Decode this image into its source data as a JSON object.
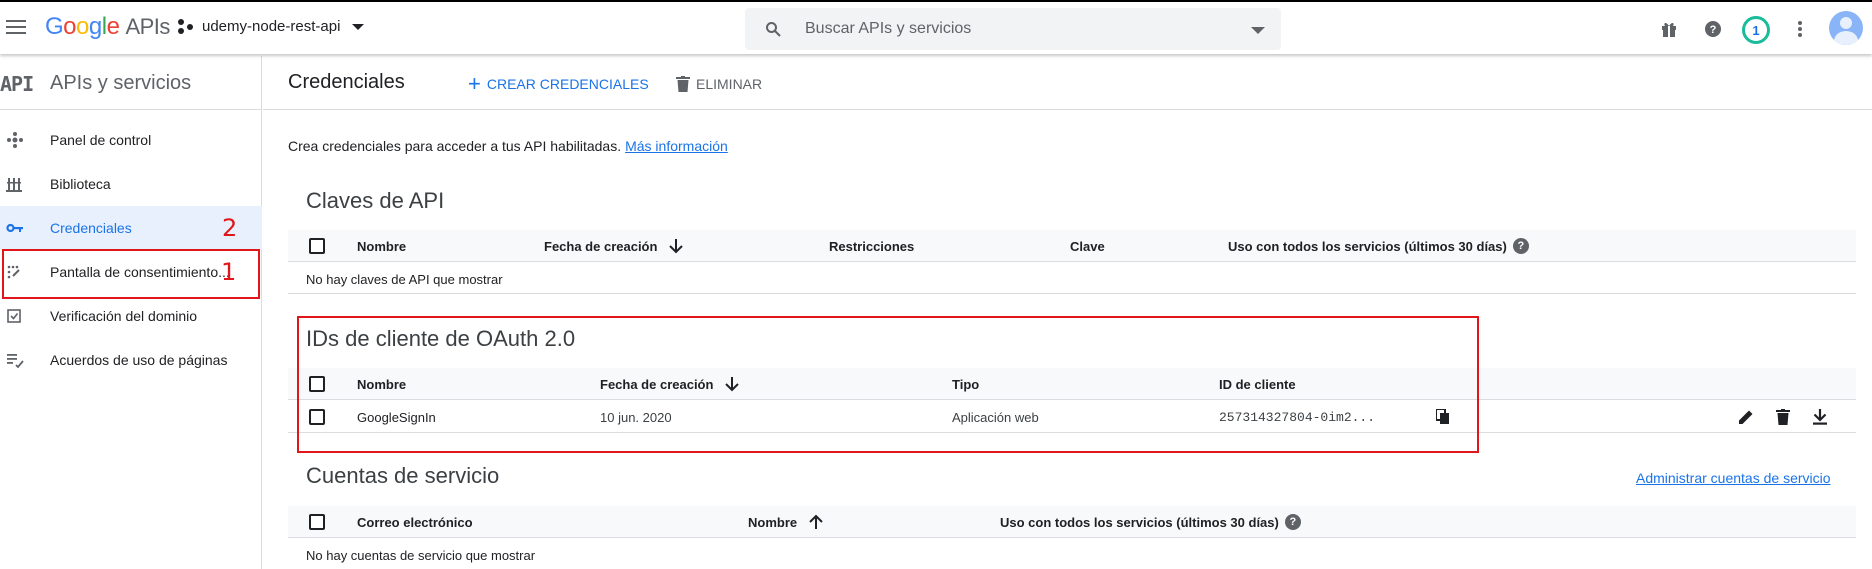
{
  "topbar": {
    "logo": {
      "g1": "G",
      "g2": "o",
      "g3": "o",
      "g4": "g",
      "g5": "l",
      "g6": "e",
      "apis": "APIs"
    },
    "project_name": "udemy-node-rest-api",
    "search_placeholder": "Buscar APIs y servicios",
    "notification_count": "1"
  },
  "sidebar": {
    "logo_text": "API",
    "title": "APIs y servicios",
    "items": [
      {
        "label": "Panel de control",
        "icon": "dashboard-icon"
      },
      {
        "label": "Biblioteca",
        "icon": "library-icon"
      },
      {
        "label": "Credenciales",
        "icon": "key-icon",
        "active": true
      },
      {
        "label": "Pantalla de consentimiento...",
        "icon": "consent-icon"
      },
      {
        "label": "Verificación del dominio",
        "icon": "domain-check-icon"
      },
      {
        "label": "Acuerdos de uso de páginas",
        "icon": "page-agreements-icon"
      }
    ]
  },
  "main": {
    "title": "Credenciales",
    "create_label": "CREAR CREDENCIALES",
    "delete_label": "ELIMINAR",
    "intro_text": "Crea credenciales para acceder a tus API habilitadas.",
    "intro_link": "Más información"
  },
  "api_keys": {
    "title": "Claves de API",
    "columns": [
      "Nombre",
      "Fecha de creación",
      "Restricciones",
      "Clave",
      "Uso con todos los servicios (últimos 30 días)"
    ],
    "empty": "No hay claves de API que mostrar"
  },
  "oauth": {
    "title": "IDs de cliente de OAuth 2.0",
    "columns": [
      "Nombre",
      "Fecha de creación",
      "Tipo",
      "ID de cliente"
    ],
    "rows": [
      {
        "name": "GoogleSignIn",
        "date": "10 jun. 2020",
        "type": "Aplicación web",
        "client_id": "257314327804-0im2..."
      }
    ]
  },
  "service_accounts": {
    "title": "Cuentas de servicio",
    "manage_link": "Administrar cuentas de servicio",
    "columns": [
      "Correo electrónico",
      "Nombre",
      "Uso con todos los servicios (últimos 30 días)"
    ],
    "empty": "No hay cuentas de servicio que mostrar"
  },
  "annotations": {
    "one": "1",
    "two": "2"
  },
  "colors": {
    "accent": "#1a73e8",
    "annotation": "#e0161b",
    "active_bg": "#e8f0fe"
  }
}
